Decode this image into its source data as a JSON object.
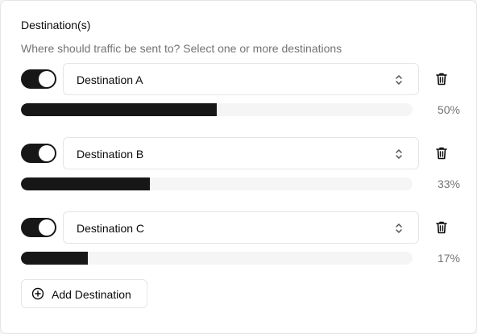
{
  "section": {
    "title": "Destination(s)",
    "subtitle": "Where should traffic be sent to? Select one or more destinations"
  },
  "destinations": [
    {
      "name": "Destination A",
      "enabled": true,
      "share": 0.5,
      "percent_label": "50%"
    },
    {
      "name": "Destination B",
      "enabled": true,
      "share": 0.33,
      "percent_label": "33%"
    },
    {
      "name": "Destination C",
      "enabled": true,
      "share": 0.17,
      "percent_label": "17%"
    }
  ],
  "add_button": {
    "label": "Add Destination",
    "icon": "plus-circle-icon"
  },
  "icons": {
    "select": "chevrons-up-down-icon",
    "delete": "trash-icon"
  },
  "colors": {
    "accent": "#171717",
    "track": "#f5f5f5",
    "muted_text": "#737373",
    "border": "#e5e5e5"
  }
}
